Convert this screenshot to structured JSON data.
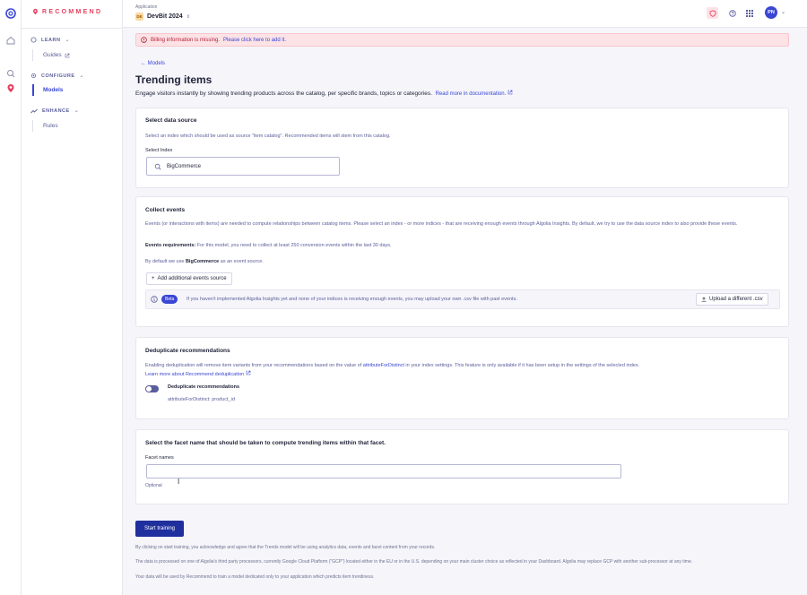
{
  "rail": {
    "icons": [
      "algolia-logo-icon",
      "home-icon",
      "search-icon",
      "recommend-icon"
    ]
  },
  "sidebar": {
    "brand": "RECOMMEND",
    "sections": [
      {
        "label": "LEARN",
        "items": [
          {
            "label": "Guides",
            "external": true
          }
        ]
      },
      {
        "label": "CONFIGURE",
        "items": [
          {
            "label": "Models",
            "active": true
          }
        ]
      },
      {
        "label": "ENHANCE",
        "items": [
          {
            "label": "Rules"
          }
        ]
      }
    ]
  },
  "topbar": {
    "app_label": "Application",
    "app_badge": "DE",
    "app_name": "DevBit 2024",
    "avatar": "PN"
  },
  "banner": {
    "text": "Billing information is missing.",
    "link": "Please click here to add it."
  },
  "page": {
    "back": "Models",
    "title": "Trending items",
    "subtitle": "Engage visitors instantly by showing trending products across the catalog, per specific brands, topics or categories.",
    "docs_link": "Read more in documentation."
  },
  "data_source": {
    "heading": "Select data source",
    "desc": "Select an index which should be used as source \"item catalog\". Recommended items will stem from this catalog.",
    "index_label": "Select Index",
    "index_value": "BigCommerce"
  },
  "events": {
    "heading": "Collect events",
    "desc": "Events (or interactions with items) are needed to compute relationships between catalog items. Please select an index - or more indices - that are receiving enough events through Algolia Insights. By default, we try to use the data source index to also provide these events.",
    "req_label": "Events requirements:",
    "req_text": " For this model, you need to collect at least 250 conversion events within the last 30 days.",
    "default_prefix": "By default we use ",
    "default_index": "BigCommerce",
    "default_suffix": " as an event source.",
    "add_button": "Add additional events source",
    "beta_label": "Beta",
    "beta_text": "If you haven't implemented Algolia Insights yet and none of your indices is receiving enough events, you may upload your own .csv file with past events.",
    "upload_button": "Upload a different .csv"
  },
  "dedup": {
    "heading": "Deduplicate recommendations",
    "desc_prefix": "Enabling deduplication will remove item variants from your recommendations based on the value of ",
    "desc_attr": "attributeForDistinct",
    "desc_suffix": " in your index settings. This feature is only available if it has been setup in the settings of the selected index.",
    "learn_link": "Learn more about Recommend deduplication",
    "toggle_label": "Deduplicate recommendations",
    "toggle_on": false,
    "attr_text": "attributeForDistinct: product_id"
  },
  "facet": {
    "heading": "Select the facet name that should be taken to compute trending items within that facet.",
    "label": "Facet names",
    "value": "",
    "hint": "Optional"
  },
  "start_button": "Start training",
  "footer": [
    "By clicking on start training, you acknowledge and agree that the Trends model will be using analytics data, events and facet content from your records.",
    "The data is processed on one of Algolia's third party processors, currently Google Cloud Platform (\"GCP\") located either in the EU or in the U.S. depending on your main cluster choice as reflected in your Dashboard. Algolia may replace GCP with another sub-processor at any time.",
    "Your data will be used by Recommend to train a model dedicated only to your application which predicts item trendiness."
  ],
  "colors": {
    "accent": "#3a46d4",
    "brand": "#e8405f",
    "primary_button": "#1f2f9e",
    "banner_bg": "#fde3e6"
  }
}
